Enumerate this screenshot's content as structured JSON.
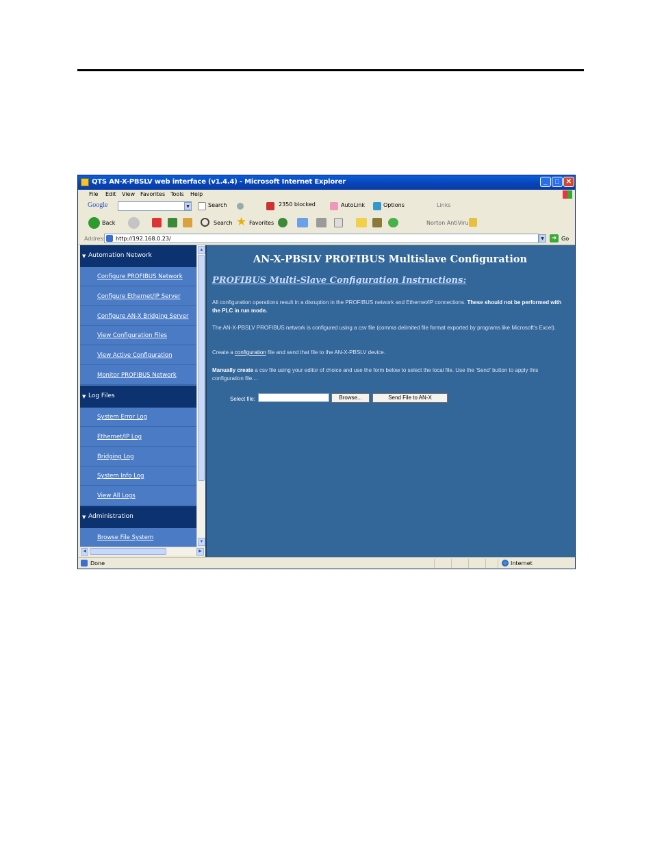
{
  "window": {
    "title": "QTS AN-X-PBSLV web interface (v1.4.4) - Microsoft Internet Explorer",
    "controls": {
      "minimize": "_",
      "maximize": "□",
      "close": "✕"
    }
  },
  "menu": [
    "File",
    "Edit",
    "View",
    "Favorites",
    "Tools",
    "Help"
  ],
  "google_toolbar": {
    "brand": "Google",
    "search": "Search",
    "blocked": "2350 blocked",
    "autolink": "AutoLink",
    "options": "Options",
    "links": "Links"
  },
  "standard_toolbar": {
    "back": "Back",
    "search": "Search",
    "favorites": "Favorites",
    "norton": "Norton AntiVirus"
  },
  "address_bar": {
    "label": "Address",
    "url": "http://192.168.0.23/",
    "go": "Go"
  },
  "sidebar": {
    "sections": [
      {
        "title": "Automation Network",
        "items": [
          "Configure PROFIBUS Network",
          "Configure Ethernet/IP Server",
          "Configure AN-X Bridging Server",
          "View Configuration Files",
          "View Active Configuration",
          "Monitor PROFIBUS Network"
        ]
      },
      {
        "title": "Log Files",
        "items": [
          "System Error Log",
          "Ethernet/IP Log",
          "Bridging Log",
          "System Info Log",
          "View All Logs"
        ]
      },
      {
        "title": "Administration",
        "items": [
          "Browse File System"
        ]
      }
    ]
  },
  "main": {
    "heading": "AN-X-PBSLV PROFIBUS Multislave Configuration",
    "subheading": "PROFIBUS Multi-Slave Configuration Instructions:",
    "p1_text": "All configuration operations result in a disruption in the PROFIBUS network and Ethernet/IP connections.",
    "p1_bold": "These should not be performed with the PLC in run mode.",
    "p2_text": "The AN-X-PBSLV PROFIBUS network is configured using a csv file (comma delimited file format exported by programs like Microsoft's Excel).",
    "p3_pre": "Create a",
    "p3_link": "configuration",
    "p3_post": "file and send that file to the AN-X-PBSLV device.",
    "p4_bold": "Manually create",
    "p4_text": "a csv file using your editor of choice and use the form below to select the local file. Use the 'Send' button to apply this configuration file....",
    "select_label": "Select file:",
    "browse_button": "Browse...",
    "send_button": "Send File to AN-X"
  },
  "status": {
    "text": "Done",
    "zone": "Internet"
  }
}
